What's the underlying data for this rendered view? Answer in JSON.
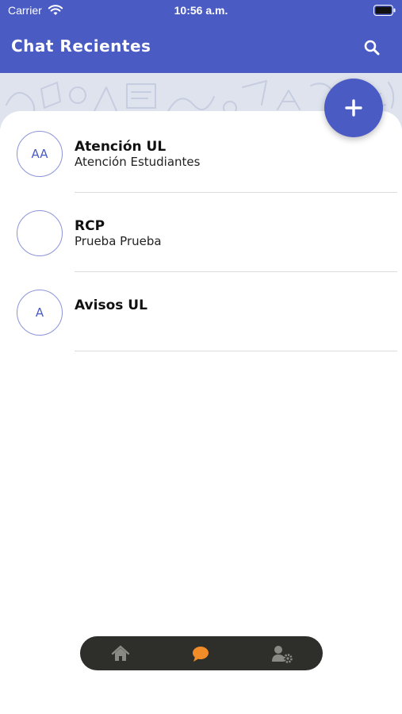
{
  "status_bar": {
    "carrier": "Carrier",
    "time": "10:56 a.m."
  },
  "header": {
    "title": "Chat Recientes",
    "search_icon": "search-icon"
  },
  "fab": {
    "icon": "plus-icon"
  },
  "chats": [
    {
      "initials": "AA",
      "name": "Atención UL",
      "subtitle": "Atención Estudiantes"
    },
    {
      "initials": "",
      "name": "RCP",
      "subtitle": "Prueba Prueba"
    },
    {
      "initials": "A",
      "name": "Avisos UL",
      "subtitle": ""
    }
  ],
  "tab_bar": {
    "items": [
      {
        "icon": "home-icon",
        "active": false
      },
      {
        "icon": "chat-bubble-icon",
        "active": true
      },
      {
        "icon": "user-settings-icon",
        "active": false
      }
    ]
  },
  "colors": {
    "primary": "#4a5bc4",
    "tab_bar_bg": "#2e2e2a",
    "tab_active": "#f28c28",
    "tab_inactive": "#8a8a84",
    "pattern_bg": "#dfe3ee"
  }
}
